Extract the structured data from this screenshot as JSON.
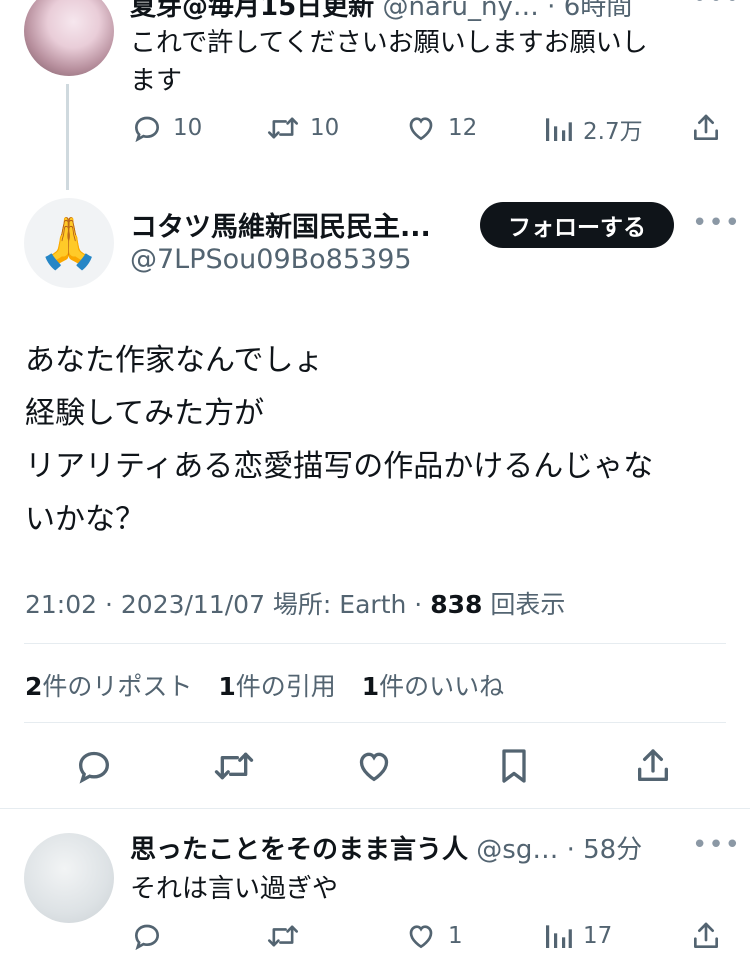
{
  "prev_tweet": {
    "display_name": "夏芽@毎月15日更新",
    "handle": "@naru_ny…",
    "time": "· 6時間",
    "text_line1": "これで許してくださいお願いしますお願いし",
    "text_line2": "ます",
    "replies": "10",
    "retweets": "10",
    "likes": "12",
    "views": "2.7万"
  },
  "main_tweet": {
    "display_name": "コタツ馬維新国民民主...",
    "handle": "@7LPSou09Bo85395",
    "follow_label": "フォローする",
    "avatar_emoji": "🙏",
    "text_lines": [
      "あなた作家なんでしょ",
      "経験してみた方が",
      "リアリティある恋愛描写の作品かけるんじゃな",
      "いかな？"
    ],
    "meta_time": "21:02 · 2023/11/07 場所: Earth · ",
    "meta_views": "838",
    "meta_views_label": "回表示",
    "reposts_count": "2",
    "reposts_label": "件のリポスト",
    "quotes_count": "1",
    "quotes_label": "件の引用",
    "likes_count": "1",
    "likes_label": "件のいいね"
  },
  "reply_tweet": {
    "display_name": "思ったことをそのまま言う人",
    "handle": "@sg…",
    "time": "· 58分",
    "text": "それは言い過ぎや",
    "replies": "",
    "retweets": "",
    "likes": "1",
    "views": "17"
  },
  "icons": {
    "reply": "reply-icon",
    "retweet": "retweet-icon",
    "like": "heart-icon",
    "views": "views-icon",
    "share": "share-icon",
    "bookmark": "bookmark-icon",
    "more": "more-icon"
  },
  "colors": {
    "text": "#0f1419",
    "secondary": "#536471",
    "follow_bg": "#0f1419",
    "divider": "#e6ecf0"
  }
}
